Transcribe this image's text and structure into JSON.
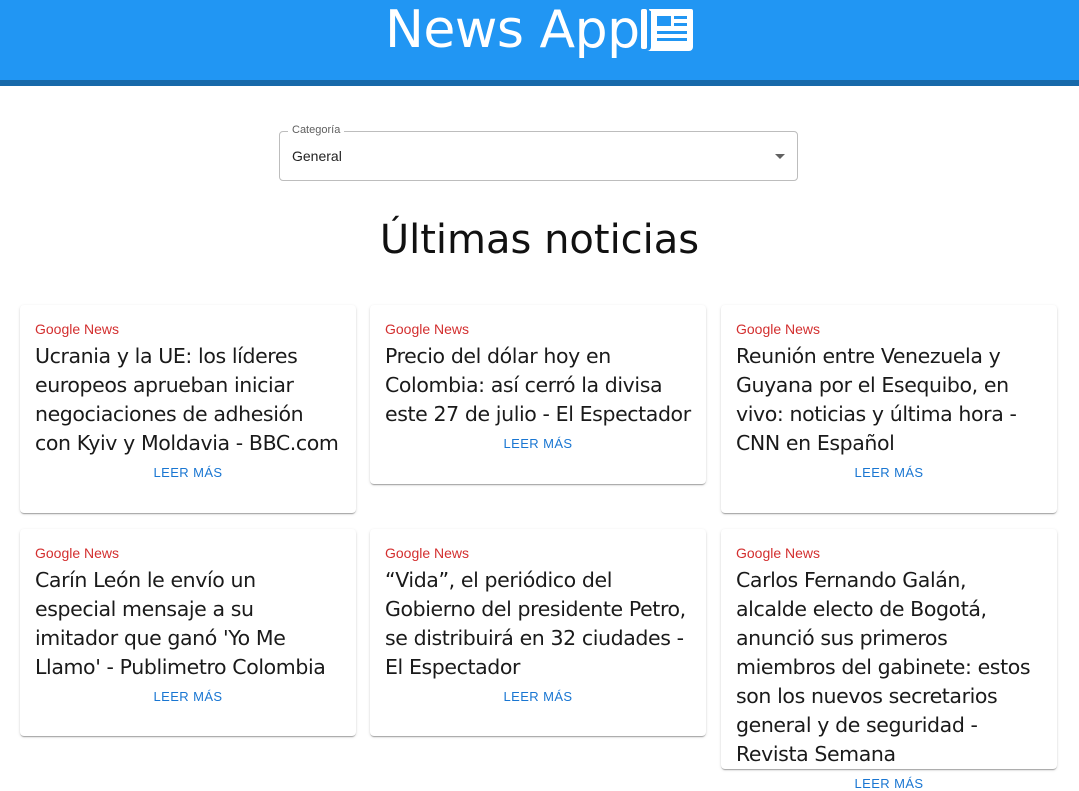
{
  "header": {
    "title": "News App",
    "icon": "newspaper-icon",
    "bg_color": "#2196f3",
    "border_color": "#1769aa"
  },
  "filter": {
    "label": "Categoría",
    "selected": "General"
  },
  "section_title": "Últimas noticias",
  "cards": [
    {
      "source": "Google News",
      "headline": "Ucrania y la UE: los líderes europeos aprueban iniciar negociaciones de adhesión con Kyiv y Moldavia - BBC.com",
      "action": "LEER MÁS"
    },
    {
      "source": "Google News",
      "headline": "Precio del dólar hoy en Colombia: así cerró la divisa este 27 de julio - El Espectador",
      "action": "LEER MÁS"
    },
    {
      "source": "Google News",
      "headline": "Reunión entre Venezuela y Guyana por el Esequibo, en vivo: noticias y última hora - CNN en Español",
      "action": "LEER MÁS"
    },
    {
      "source": "Google News",
      "headline": "Carín León le envío un especial mensaje a su imitador que ganó 'Yo Me Llamo' - Publimetro Colombia",
      "action": "LEER MÁS"
    },
    {
      "source": "Google News",
      "headline": "“Vida”, el periódico del Gobierno del presidente Petro, se distribuirá en 32 ciudades - El Espectador",
      "action": "LEER MÁS"
    },
    {
      "source": "Google News",
      "headline": "Carlos Fernando Galán, alcalde electo de Bogotá, anunció sus primeros miembros del gabinete: estos son los nuevos secretarios general y de seguridad - Revista Semana",
      "action": "LEER MÁS"
    }
  ],
  "colors": {
    "source_text": "#d32f2f",
    "action_text": "#1976d2"
  }
}
